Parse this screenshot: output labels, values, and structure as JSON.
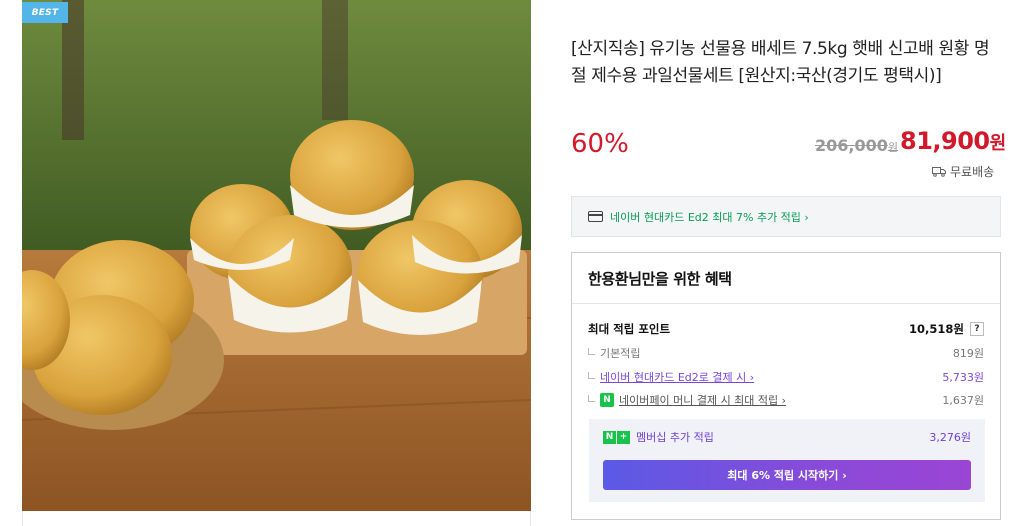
{
  "badge": "BEST",
  "product": {
    "title": "[산지직송] 유기농 선물용 배세트 7.5kg 햇배 신고배 원황 명절 제수용 과일선물세트 [원산지:국산(경기도 평택시)]",
    "discount": "60%",
    "original_price": "206,000",
    "original_price_unit": "원",
    "sale_price": "81,900",
    "sale_price_unit": "원",
    "shipping": "무료배송"
  },
  "card_promo": {
    "text": "네이버 현대카드 Ed2 최대 7% 추가 적립 ›",
    "icon": "credit-card-icon"
  },
  "benefit": {
    "title": "한용환님만을 위한 혜택",
    "max_points_label": "최대 적립 포인트",
    "max_points_value": "10,518원",
    "help": "?",
    "basic_label": "기본적립",
    "basic_value": "819원",
    "card_label": "네이버 현대카드 Ed2로 결제 시 ›",
    "card_value": "5,733원",
    "npay_icon": "N",
    "npay_label": "네이버페이 머니 결제 시 최대 적립 ›",
    "npay_value": "1,637원",
    "member_badge_n": "N",
    "member_badge_plus": "+",
    "member_label": "멤버십 추가 적립",
    "member_value": "3,276원",
    "member_button": "최대 6% 적립 시작하기 ›"
  },
  "colors": {
    "accent_red": "#d2192a",
    "naver_green": "#19c24a",
    "purple": "#7b45d8",
    "badge_blue": "#54b6e8"
  }
}
